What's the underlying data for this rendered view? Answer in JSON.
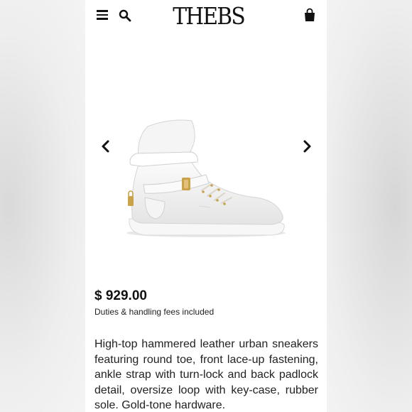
{
  "header": {
    "logo_text": "THEBS",
    "menu_icon": "hamburger-menu-icon",
    "search_icon": "search-icon",
    "cart_icon": "shopping-bag-icon"
  },
  "carousel": {
    "prev_icon": "chevron-left-icon",
    "next_icon": "chevron-right-icon"
  },
  "product": {
    "price": "$ 929.00",
    "duties_note": "Duties & handling fees included",
    "description": "High-top hammered leather urban sneakers featuring round toe, front lace-up fastening, ankle strap with turn-lock and back padlock detail, oversize loop with key-case, rubber sole. Gold-tone hardware."
  },
  "colors": {
    "text": "#111111",
    "background": "#ffffff",
    "hardware_gold": "#c9a24a"
  }
}
